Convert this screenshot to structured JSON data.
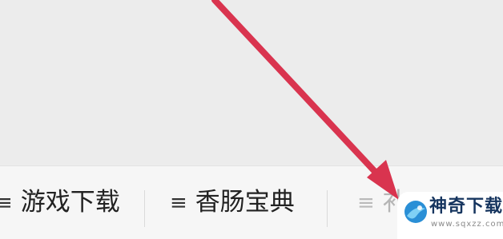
{
  "bottom_nav": {
    "tabs": [
      {
        "icon": "menu-icon",
        "icon_glyph": "≡",
        "label": "游戏下载"
      },
      {
        "icon": "menu-icon",
        "icon_glyph": "≡",
        "label": "香肠宝典"
      },
      {
        "icon": "menu-icon",
        "icon_glyph": "≡",
        "label": "补"
      }
    ]
  },
  "annotation": {
    "type": "arrow",
    "color": "#d9344f"
  },
  "watermark": {
    "logo": "sqxzz-logo-icon",
    "title": "神奇下载",
    "url": "www.sqxzz.com"
  }
}
